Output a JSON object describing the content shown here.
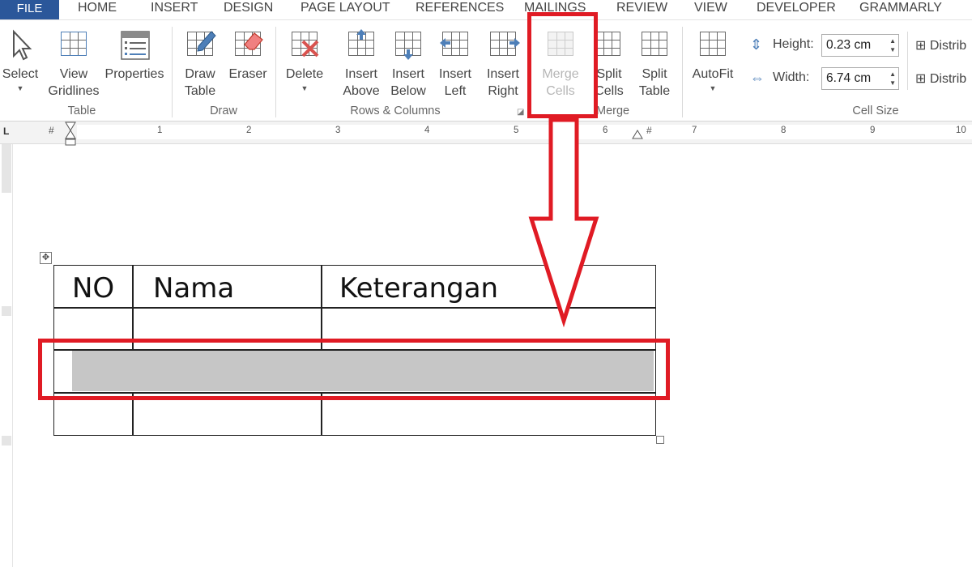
{
  "tabs": {
    "file": "FILE",
    "home": "HOME",
    "insert": "INSERT",
    "design": "DESIGN",
    "page_layout": "PAGE LAYOUT",
    "references": "REFERENCES",
    "mailings": "MAILINGS",
    "review": "REVIEW",
    "view": "VIEW",
    "developer": "DEVELOPER",
    "grammarly": "GRAMMARLY"
  },
  "ribbon": {
    "table_group": {
      "label": "Table",
      "select": "Select",
      "view_gridlines": [
        "View",
        "Gridlines"
      ],
      "properties": "Properties"
    },
    "draw_group": {
      "label": "Draw",
      "draw_table": [
        "Draw",
        "Table"
      ],
      "eraser": "Eraser"
    },
    "rows_columns_group": {
      "label": "Rows & Columns",
      "delete": "Delete",
      "insert_above": [
        "Insert",
        "Above"
      ],
      "insert_below": [
        "Insert",
        "Below"
      ],
      "insert_left": [
        "Insert",
        "Left"
      ],
      "insert_right": [
        "Insert",
        "Right"
      ]
    },
    "merge_group": {
      "label": "Merge",
      "merge_cells": [
        "Merge",
        "Cells"
      ],
      "split_cells": [
        "Split",
        "Cells"
      ],
      "split_table": [
        "Split",
        "Table"
      ]
    },
    "cell_size_group": {
      "label": "Cell Size",
      "autofit": "AutoFit",
      "height_label": "Height:",
      "height_value": "0.23 cm",
      "width_label": "Width:",
      "width_value": "6.74 cm",
      "distribute_rows": "Distrib",
      "distribute_columns": "Distrib"
    }
  },
  "ruler": {
    "marks": [
      "1",
      "2",
      "3",
      "4",
      "5",
      "6",
      "7",
      "8",
      "9",
      "10"
    ]
  },
  "document": {
    "table": {
      "headers": [
        "NO",
        "Nama",
        "Keterangan"
      ],
      "rows": 4,
      "selected_row": 3
    }
  },
  "colors": {
    "file_tab": "#2b579a",
    "annotation_red": "#e01b24",
    "selection_grey": "#c6c6c6"
  }
}
